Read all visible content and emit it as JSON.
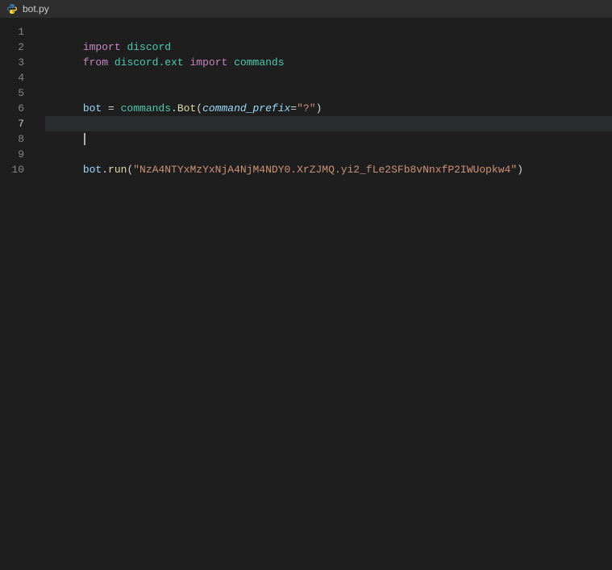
{
  "titlebar": {
    "filename": "bot.py",
    "icon": "python-icon"
  },
  "editor": {
    "background": "#1e1e1e",
    "highlight_line": "#2a2d2e",
    "lines": [
      {
        "number": 1,
        "tokens": [
          {
            "type": "kw-import",
            "text": "import"
          },
          {
            "type": "plain",
            "text": " "
          },
          {
            "type": "module",
            "text": "discord"
          }
        ]
      },
      {
        "number": 2,
        "tokens": [
          {
            "type": "kw-from",
            "text": "from"
          },
          {
            "type": "plain",
            "text": " "
          },
          {
            "type": "module",
            "text": "discord.ext"
          },
          {
            "type": "plain",
            "text": " "
          },
          {
            "type": "kw-import",
            "text": "import"
          },
          {
            "type": "plain",
            "text": " "
          },
          {
            "type": "module",
            "text": "commands"
          }
        ]
      },
      {
        "number": 3,
        "tokens": []
      },
      {
        "number": 4,
        "tokens": []
      },
      {
        "number": 5,
        "tokens": [
          {
            "type": "var",
            "text": "bot"
          },
          {
            "type": "plain",
            "text": " = "
          },
          {
            "type": "module",
            "text": "commands"
          },
          {
            "type": "plain",
            "text": "."
          },
          {
            "type": "builtin",
            "text": "Bot"
          },
          {
            "type": "plain",
            "text": "("
          },
          {
            "type": "param",
            "text": "command_prefix"
          },
          {
            "type": "plain",
            "text": "="
          },
          {
            "type": "string",
            "text": "\"?\""
          },
          {
            "type": "plain",
            "text": ")"
          }
        ]
      },
      {
        "number": 6,
        "tokens": []
      },
      {
        "number": 7,
        "tokens": [],
        "cursor": true
      },
      {
        "number": 8,
        "tokens": []
      },
      {
        "number": 9,
        "tokens": [
          {
            "type": "var",
            "text": "bot"
          },
          {
            "type": "plain",
            "text": "."
          },
          {
            "type": "builtin",
            "text": "run"
          },
          {
            "type": "plain",
            "text": "("
          },
          {
            "type": "string",
            "text": "\"NzA4NTYxMzYxNjA4NjM4NDY0.XrZJMQ.yi2_fLe2SFb8vNnxfP2IWUopkw4\""
          },
          {
            "type": "plain",
            "text": ")"
          }
        ]
      },
      {
        "number": 10,
        "tokens": []
      }
    ]
  }
}
